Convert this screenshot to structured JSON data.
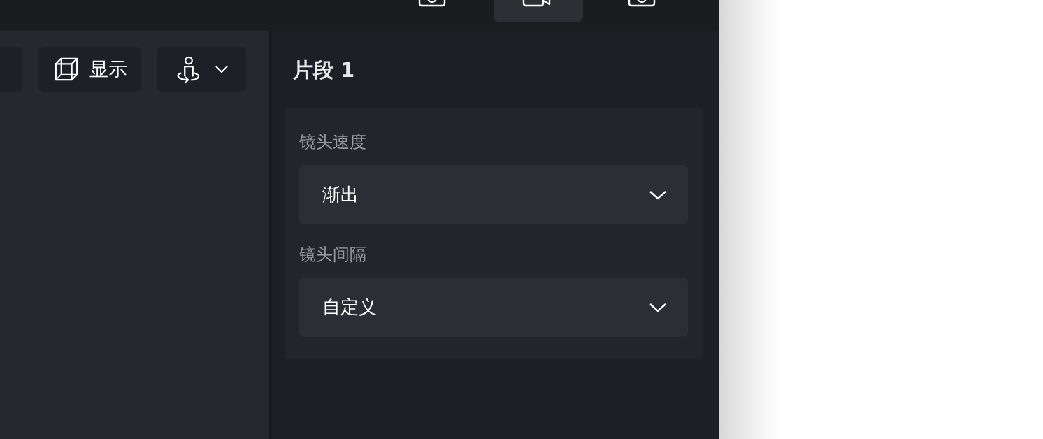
{
  "top_tabs": [
    {
      "kind": "photo",
      "selected": false
    },
    {
      "kind": "video",
      "selected": true
    },
    {
      "kind": "photo",
      "selected": false
    }
  ],
  "toolbar": {
    "display_button": {
      "label": "显示"
    },
    "view_dropdown": {
      "kind": "dropdown"
    }
  },
  "panel": {
    "title": "片段 1",
    "fields": [
      {
        "label": "镜头速度",
        "value": "渐出"
      },
      {
        "label": "镜头间隔",
        "value": "自定义"
      }
    ]
  }
}
